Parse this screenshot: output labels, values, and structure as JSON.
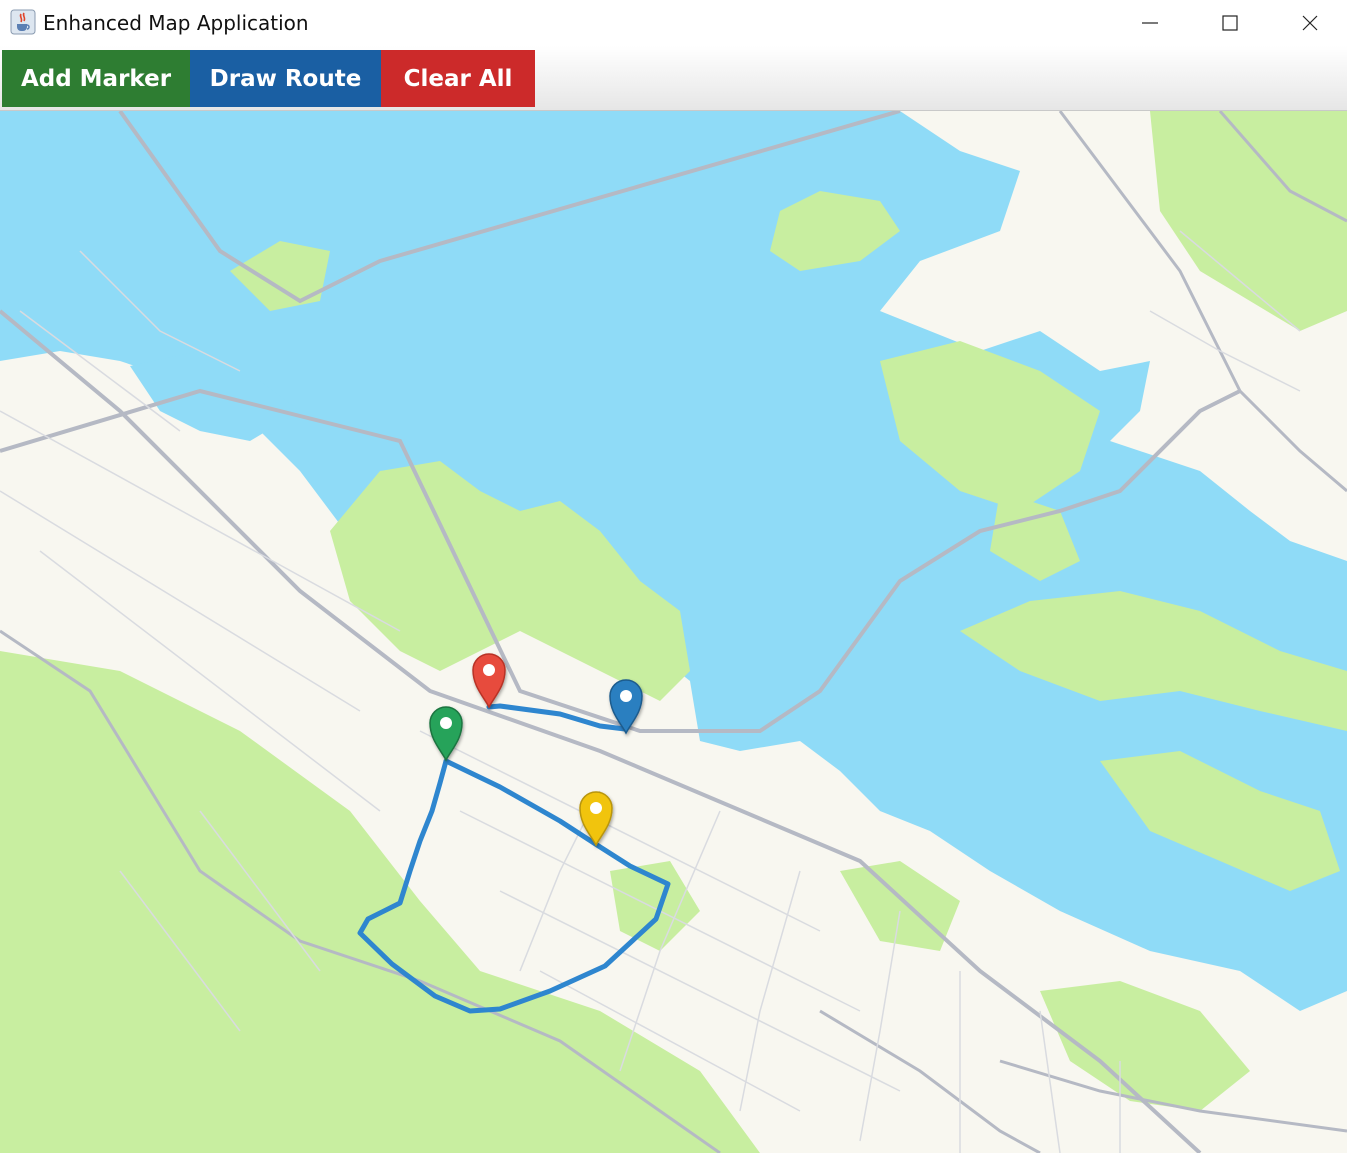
{
  "window": {
    "title": "Enhanced Map Application",
    "app_icon": "java-cup-icon",
    "controls": [
      "minimize-icon",
      "maximize-icon",
      "close-icon"
    ]
  },
  "toolbar": {
    "buttons": [
      {
        "label": "Add Marker",
        "color": "#2e7d32"
      },
      {
        "label": "Draw Route",
        "color": "#1a5fa3"
      },
      {
        "label": "Clear All",
        "color": "#cc2a2a"
      }
    ]
  },
  "map": {
    "colors": {
      "water": "#8fdbf7",
      "land": "#f8f7f0",
      "park": "#c8eea0",
      "road": "#b5b9c4",
      "route": "#2e86cf"
    },
    "markers": [
      {
        "name": "red-marker",
        "color": "#e74c3c"
      },
      {
        "name": "blue-marker",
        "color": "#2c7fc0"
      },
      {
        "name": "green-marker",
        "color": "#27a35a"
      },
      {
        "name": "yellow-marker",
        "color": "#f1c40f"
      }
    ]
  }
}
